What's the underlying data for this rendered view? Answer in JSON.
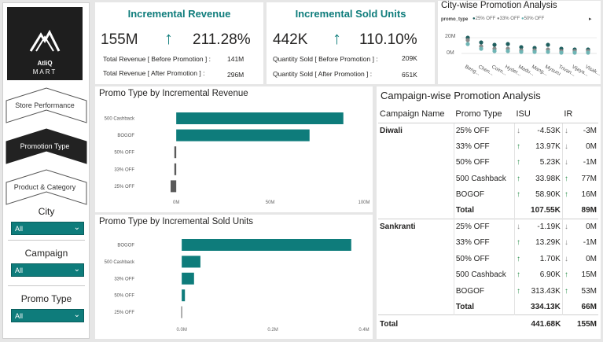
{
  "logo": {
    "line1": "AtliQ",
    "line2": "MART"
  },
  "nav": [
    {
      "label": "Store Performance",
      "active": false
    },
    {
      "label": "Promotion Type",
      "active": true
    },
    {
      "label": "Product & Category",
      "active": false
    }
  ],
  "slicers": [
    {
      "title": "City",
      "value": "All"
    },
    {
      "title": "Campaign",
      "value": "All"
    },
    {
      "title": "Promo Type",
      "value": "All"
    }
  ],
  "kpi_revenue": {
    "title": "Incremental Revenue",
    "value": "155M",
    "pct": "211.28%",
    "before_label": "Total Revenue [ Before Promotion ] :",
    "before_value": "141M",
    "after_label": "Total Revenue [ After Promotion ] :",
    "after_value": "296M"
  },
  "kpi_units": {
    "title": "Incremental Sold Units",
    "value": "442K",
    "pct": "110.10%",
    "before_label": "Quantity Sold [ Before Promotion ] :",
    "before_value": "209K",
    "after_label": "Quantity Sold [ After Promotion ] :",
    "after_value": "651K"
  },
  "city_chart": {
    "title": "City-wise Promotion Analysis",
    "legend_title": "promo_type",
    "legend": [
      {
        "label": "25% OFF",
        "color": "#1f5f5f"
      },
      {
        "label": "33% OFF",
        "color": "#8a8a8a"
      },
      {
        "label": "50% OFF",
        "color": "#6fb5b5"
      }
    ],
    "y_ticks": [
      "20M",
      "0M"
    ],
    "cities": [
      "Beng...",
      "Chen...",
      "Coim...",
      "Hyder...",
      "Madu...",
      "Mang...",
      "Mysuru",
      "Trivan...",
      "Vijaya...",
      "Visak..."
    ]
  },
  "chart_data": [
    {
      "type": "bar",
      "title": "Promo Type by Incremental Revenue",
      "categories": [
        "500 Cashback",
        "BOGOF",
        "50% OFF",
        "33% OFF",
        "25% OFF"
      ],
      "values": [
        89,
        71,
        -1,
        -1,
        -3
      ],
      "unit": "M",
      "xlim": [
        -3,
        100
      ],
      "x_ticks": [
        "0M",
        "50M",
        "100M"
      ],
      "colors": [
        "#0e7c7b",
        "#0e7c7b",
        "#5a5a5a",
        "#5a5a5a",
        "#5a5a5a"
      ]
    },
    {
      "type": "bar",
      "title": "Promo Type by Incremental Sold Units",
      "categories": [
        "BOGOF",
        "500 Cashback",
        "33% OFF",
        "50% OFF",
        "25% OFF"
      ],
      "values": [
        0.372,
        0.041,
        0.027,
        0.007,
        -0.001
      ],
      "unit": "M",
      "xlim": [
        -0.002,
        0.4
      ],
      "x_ticks": [
        "0.0M",
        "0.2M",
        "0.4M"
      ],
      "colors": [
        "#0e7c7b",
        "#0e7c7b",
        "#0e7c7b",
        "#0e7c7b",
        "#5a5a5a"
      ]
    }
  ],
  "campaign_table": {
    "title": "Campaign-wise Promotion Analysis",
    "headers": [
      "Campaign Name",
      "Promo Type",
      "ISU",
      "IR"
    ],
    "groups": [
      {
        "name": "Diwali",
        "rows": [
          {
            "promo": "25% OFF",
            "isu_dir": "down",
            "isu": "-4.53K",
            "ir_dir": "down",
            "ir": "-3M"
          },
          {
            "promo": "33% OFF",
            "isu_dir": "up",
            "isu": "13.97K",
            "ir_dir": "down",
            "ir": "0M"
          },
          {
            "promo": "50% OFF",
            "isu_dir": "up",
            "isu": "5.23K",
            "ir_dir": "down",
            "ir": "-1M"
          },
          {
            "promo": "500 Cashback",
            "isu_dir": "up",
            "isu": "33.98K",
            "ir_dir": "up",
            "ir": "77M"
          },
          {
            "promo": "BOGOF",
            "isu_dir": "up",
            "isu": "58.90K",
            "ir_dir": "up",
            "ir": "16M"
          }
        ],
        "total_label": "Total",
        "total_isu": "107.55K",
        "total_ir": "89M"
      },
      {
        "name": "Sankranti",
        "rows": [
          {
            "promo": "25% OFF",
            "isu_dir": "down",
            "isu": "-1.19K",
            "ir_dir": "down",
            "ir": "0M"
          },
          {
            "promo": "33% OFF",
            "isu_dir": "up",
            "isu": "13.29K",
            "ir_dir": "down",
            "ir": "-1M"
          },
          {
            "promo": "50% OFF",
            "isu_dir": "up",
            "isu": "1.70K",
            "ir_dir": "down",
            "ir": "0M"
          },
          {
            "promo": "500 Cashback",
            "isu_dir": "up",
            "isu": "6.90K",
            "ir_dir": "up",
            "ir": "15M"
          },
          {
            "promo": "BOGOF",
            "isu_dir": "up",
            "isu": "313.43K",
            "ir_dir": "up",
            "ir": "53M"
          }
        ],
        "total_label": "Total",
        "total_isu": "334.13K",
        "total_ir": "66M"
      }
    ],
    "grand_total_label": "Total",
    "grand_total_isu": "441.68K",
    "grand_total_ir": "155M"
  }
}
